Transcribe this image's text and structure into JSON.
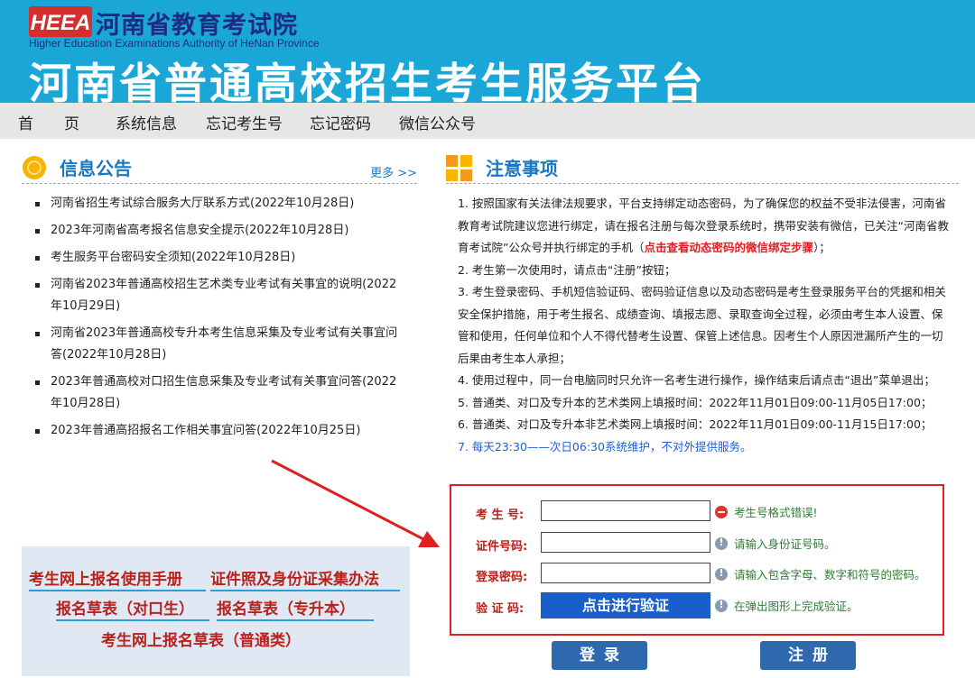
{
  "header": {
    "logo_text": "HEEA",
    "org_name": "河南省教育考试院",
    "org_name_en": "Higher Education Examinations Authority of HeNan Province",
    "site_title": "河南省普通高校招生考生服务平台"
  },
  "nav": {
    "items": [
      "首　　页",
      "系统信息",
      "忘记考生号",
      "忘记密码",
      "微信公众号"
    ]
  },
  "announcements": {
    "title": "信息公告",
    "more_label": "更多 >>",
    "items": [
      "河南省招生考试综合服务大厅联系方式(2022年10月28日)",
      "2023年河南省高考报名信息安全提示(2022年10月28日)",
      "考生服务平台密码安全须知(2022年10月28日)",
      "河南省2023年普通高校招生艺术类专业考试有关事宜的说明(2022年10月29日)",
      "河南省2023年普通高校专升本考生信息采集及专业考试有关事宜问答(2022年10月28日)",
      "2023年普通高校对口招生信息采集及专业考试有关事宜问答(2022年10月28日)",
      "2023年普通高招报名工作相关事宜问答(2022年10月25日)"
    ]
  },
  "notes": {
    "title": "注意事项",
    "rule1_pre": "1. 按照国家有关法律法规要求，平台支持绑定动态密码，为了确保您的权益不受非法侵害，河南省教育考试院建议您进行绑定，请在报名注册与每次登录系统时，携带安装有微信，已关注“河南省教育考试院”公众号并执行绑定的手机（",
    "rule1_link": "点击查看动态密码的微信绑定步骤",
    "rule1_post": "）；",
    "rule2": "2. 考生第一次使用时，请点击“注册”按钮；",
    "rule3": "3. 考生登录密码、手机短信验证码、密码验证信息以及动态密码是考生登录服务平台的凭据和相关安全保护措施，用于考生报名、成绩查询、填报志愿、录取查询全过程，必须由考生本人设置、保管和使用，任何单位和个人不得代替考生设置、保管上述信息。因考生个人原因泄漏所产生的一切后果由考生本人承担；",
    "rule4": "4. 使用过程中，同一台电脑同时只允许一名考生进行操作，操作结束后请点击“退出”菜单退出；",
    "rule5": "5. 普通类、对口及专升本的艺术类网上填报时间：2022年11月01日09:00-11月05日17:00；",
    "rule6": "6. 普通类、对口及专升本非艺术类网上填报时间：2022年11月01日09:00-11月15日17:00；",
    "rule7": "7. 每天23:30——次日06:30系统维护，不对外提供服务。"
  },
  "manuals": {
    "link1": "考生网上报名使用手册",
    "link2": "证件照及身份证采集办法",
    "link3": "报名草表（对口生）",
    "link4": "报名草表（专升本）",
    "link5": "考生网上报名草表（普通类）"
  },
  "form": {
    "exam_no_label": "考 生 号:",
    "exam_no_value": "",
    "exam_no_hint": "考生号格式错误!",
    "id_label": "证件号码:",
    "id_value": "",
    "id_hint": "请输入身份证号码。",
    "pwd_label": "登录密码:",
    "pwd_value": "",
    "pwd_hint": "请输入包含字母、数字和符号的密码。",
    "captcha_label": "验 证 码:",
    "captcha_button": "点击进行验证",
    "captcha_hint": "在弹出图形上完成验证。"
  },
  "actions": {
    "login": "登录",
    "register": "注册"
  },
  "colors": {
    "header_bg": "#1aa7d8",
    "nav_bg": "#e6e6e6",
    "title_blue": "#1a78c2",
    "label_red": "#b8211c",
    "button_blue": "#2f69ad",
    "arrow_red": "#e02020"
  }
}
